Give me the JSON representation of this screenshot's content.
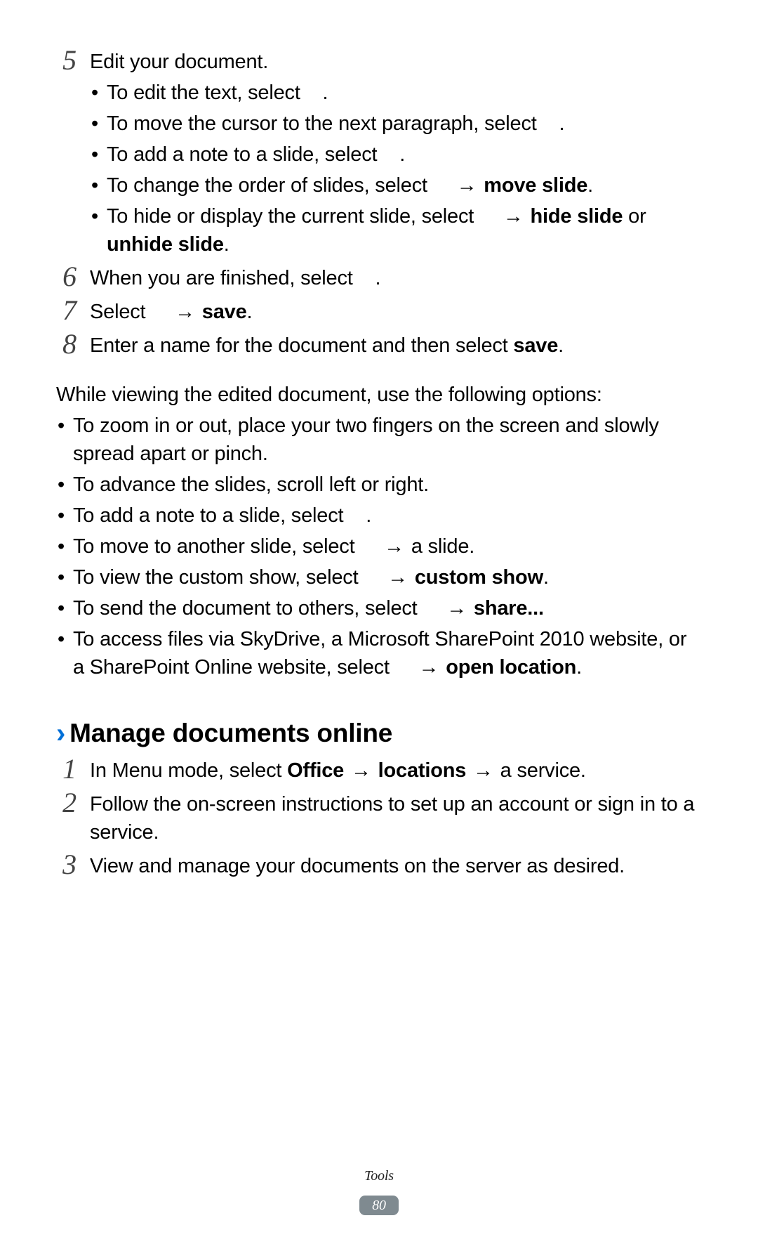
{
  "footer": {
    "section": "Tools",
    "page": "80"
  },
  "steps_a": [
    {
      "num": "5",
      "lead": "Edit your document.",
      "bullets": [
        {
          "segments": [
            {
              "t": "To edit the text, select "
            },
            {
              "icon": true
            },
            {
              "t": "."
            }
          ]
        },
        {
          "segments": [
            {
              "t": "To move the cursor to the next paragraph, select "
            },
            {
              "icon": true
            },
            {
              "t": "."
            }
          ]
        },
        {
          "segments": [
            {
              "t": "To add a note to a slide, select "
            },
            {
              "icon": true
            },
            {
              "t": "."
            }
          ]
        },
        {
          "segments": [
            {
              "t": "To change the order of slides, select "
            },
            {
              "icon": true
            },
            {
              "t": " "
            },
            {
              "arrow": true
            },
            {
              "t": " "
            },
            {
              "b": "move slide"
            },
            {
              "t": "."
            }
          ]
        },
        {
          "segments": [
            {
              "t": "To hide or display the current slide, select "
            },
            {
              "icon": true
            },
            {
              "t": " "
            },
            {
              "arrow": true
            },
            {
              "t": " "
            },
            {
              "b": "hide slide"
            },
            {
              "t": " or "
            },
            {
              "b": "unhide slide"
            },
            {
              "t": "."
            }
          ]
        }
      ]
    },
    {
      "num": "6",
      "segments": [
        {
          "t": "When you are finished, select "
        },
        {
          "icon": true
        },
        {
          "t": "."
        }
      ]
    },
    {
      "num": "7",
      "segments": [
        {
          "t": "Select "
        },
        {
          "icon": true
        },
        {
          "t": " "
        },
        {
          "arrow": true
        },
        {
          "t": " "
        },
        {
          "b": "save"
        },
        {
          "t": "."
        }
      ]
    },
    {
      "num": "8",
      "segments": [
        {
          "t": "Enter a name for the document and then select "
        },
        {
          "b": "save"
        },
        {
          "t": "."
        }
      ]
    }
  ],
  "paragraph": "While viewing the edited document, use the following options:",
  "mid_bullets": [
    {
      "segments": [
        {
          "t": "To zoom in or out, place your two fingers on the screen and slowly spread apart or pinch."
        }
      ]
    },
    {
      "segments": [
        {
          "t": "To advance the slides, scroll left or right."
        }
      ]
    },
    {
      "segments": [
        {
          "t": "To add a note to a slide, select "
        },
        {
          "icon": true
        },
        {
          "t": "."
        }
      ]
    },
    {
      "segments": [
        {
          "t": "To move to another slide, select "
        },
        {
          "icon": true
        },
        {
          "t": " "
        },
        {
          "arrow": true
        },
        {
          "t": " a slide."
        }
      ]
    },
    {
      "segments": [
        {
          "t": "To view the custom show, select "
        },
        {
          "icon": true
        },
        {
          "t": " "
        },
        {
          "arrow": true
        },
        {
          "t": " "
        },
        {
          "b": "custom show"
        },
        {
          "t": "."
        }
      ]
    },
    {
      "segments": [
        {
          "t": "To send the document to others, select "
        },
        {
          "icon": true
        },
        {
          "t": " "
        },
        {
          "arrow": true
        },
        {
          "t": " "
        },
        {
          "b": "share..."
        }
      ]
    },
    {
      "segments": [
        {
          "t": "To access files via SkyDrive, a Microsoft SharePoint 2010 website, or a SharePoint Online website, select "
        },
        {
          "icon": true
        },
        {
          "t": " "
        },
        {
          "arrow": true
        },
        {
          "t": " "
        },
        {
          "b": "open location"
        },
        {
          "t": "."
        }
      ]
    }
  ],
  "section_title": "Manage documents online",
  "steps_b": [
    {
      "num": "1",
      "segments": [
        {
          "t": "In Menu mode, select "
        },
        {
          "b": "Office"
        },
        {
          "t": " "
        },
        {
          "arrow": true
        },
        {
          "t": " "
        },
        {
          "b": "locations"
        },
        {
          "t": " "
        },
        {
          "arrow": true
        },
        {
          "t": " a service."
        }
      ]
    },
    {
      "num": "2",
      "segments": [
        {
          "t": "Follow the on-screen instructions to set up an account or sign in to a service."
        }
      ]
    },
    {
      "num": "3",
      "segments": [
        {
          "t": "View and manage your documents on the server as desired."
        }
      ]
    }
  ],
  "glyphs": {
    "arrow": "→"
  }
}
